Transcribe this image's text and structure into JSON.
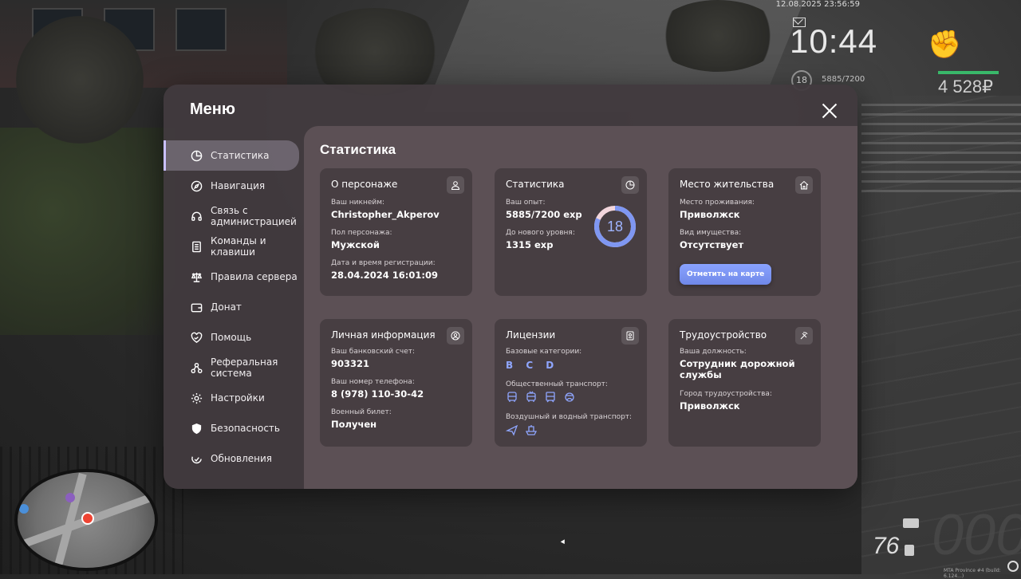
{
  "hud": {
    "datetime": "12.08.2025 23:56:59",
    "clock": "10:44",
    "level": "18",
    "exp": "5885/7200",
    "money": "4 528₽",
    "speed": "76",
    "speed_bg": "000",
    "build": "MTA Province #4 (build: 6.124...)"
  },
  "menu": {
    "title": "Меню",
    "sidebar": [
      {
        "label": "Статистика",
        "icon": "pie-chart-icon",
        "active": true
      },
      {
        "label": "Навигация",
        "icon": "compass-icon"
      },
      {
        "label": "Связь с администрацией",
        "icon": "headset-icon"
      },
      {
        "label": "Команды и клавиши",
        "icon": "document-icon"
      },
      {
        "label": "Правила сервера",
        "icon": "scales-icon"
      },
      {
        "label": "Донат",
        "icon": "wallet-icon"
      },
      {
        "label": "Помощь",
        "icon": "heart-handshake-icon"
      },
      {
        "label": "Реферальная система",
        "icon": "network-icon"
      },
      {
        "label": "Настройки",
        "icon": "gear-icon"
      },
      {
        "label": "Безопасность",
        "icon": "shield-icon"
      },
      {
        "label": "Обновления",
        "icon": "refresh-check-icon"
      }
    ]
  },
  "content": {
    "title": "Статистика",
    "character": {
      "title": "О персонаже",
      "nickname_label": "Ваш никнейм:",
      "nickname": "Christopher_Akperov",
      "gender_label": "Пол персонажа:",
      "gender": "Мужской",
      "reg_label": "Дата и время регистрации:",
      "reg": "28.04.2024 16:01:09"
    },
    "stats": {
      "title": "Статистика",
      "exp_label": "Ваш опыт:",
      "exp": "5885/7200 exp",
      "next_label": "До нового уровня:",
      "next": "1315 exp",
      "level": "18",
      "level_progress": 0.817
    },
    "residence": {
      "title": "Место жительства",
      "place_label": "Место проживания:",
      "place": "Приволжск",
      "property_label": "Вид имущества:",
      "property": "Отсутствует",
      "button": "Отметить на карте"
    },
    "personal": {
      "title": "Личная информация",
      "bank_label": "Ваш банковский счет:",
      "bank": "903321",
      "phone_label": "Ваш номер телефона:",
      "phone": "8 (978) 110-30-42",
      "military_label": "Военный билет:",
      "military": "Получен"
    },
    "licenses": {
      "title": "Лицензии",
      "base_label": "Базовые категории:",
      "base": "B C D",
      "public_label": "Общественный транспорт:",
      "air_label": "Воздушный и водный транспорт:"
    },
    "employment": {
      "title": "Трудоустройство",
      "position_label": "Ваша должность:",
      "position": "Сотрудник дорожной службы",
      "city_label": "Город трудоустройства:",
      "city": "Приволжск"
    }
  }
}
